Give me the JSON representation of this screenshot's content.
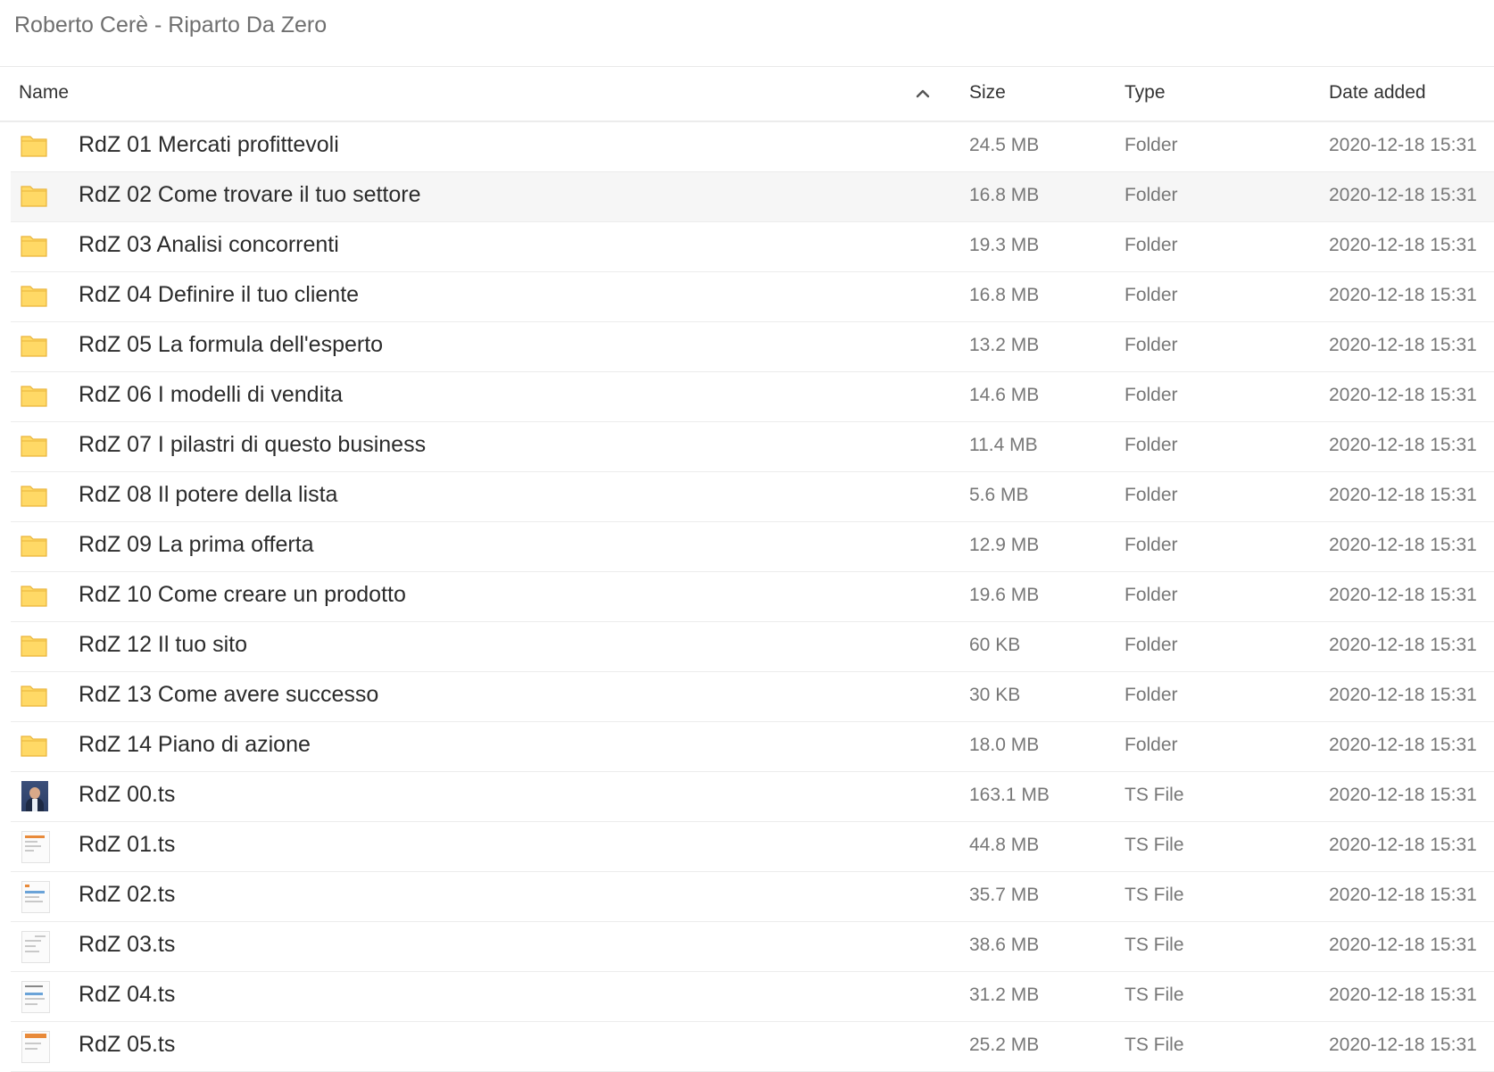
{
  "breadcrumb": {
    "path": "Roberto Cerè - Riparto Da Zero"
  },
  "columns": {
    "name": "Name",
    "size": "Size",
    "type": "Type",
    "date_added": "Date added"
  },
  "rows": [
    {
      "name": "RdZ 01 Mercati profittevoli",
      "size": "24.5 MB",
      "type": "Folder",
      "date": "2020-12-18 15:31",
      "icon": "folder-icon"
    },
    {
      "name": "RdZ 02 Come trovare il tuo settore",
      "size": "16.8 MB",
      "type": "Folder",
      "date": "2020-12-18 15:31",
      "icon": "folder-icon"
    },
    {
      "name": "RdZ 03 Analisi concorrenti",
      "size": "19.3 MB",
      "type": "Folder",
      "date": "2020-12-18 15:31",
      "icon": "folder-icon"
    },
    {
      "name": "RdZ 04 Definire il tuo cliente",
      "size": "16.8 MB",
      "type": "Folder",
      "date": "2020-12-18 15:31",
      "icon": "folder-icon"
    },
    {
      "name": "RdZ 05 La formula dell'esperto",
      "size": "13.2 MB",
      "type": "Folder",
      "date": "2020-12-18 15:31",
      "icon": "folder-icon"
    },
    {
      "name": "RdZ 06 I modelli di vendita",
      "size": "14.6 MB",
      "type": "Folder",
      "date": "2020-12-18 15:31",
      "icon": "folder-icon"
    },
    {
      "name": "RdZ 07 I pilastri di questo business",
      "size": "11.4 MB",
      "type": "Folder",
      "date": "2020-12-18 15:31",
      "icon": "folder-icon"
    },
    {
      "name": "RdZ 08 Il potere della lista",
      "size": "5.6 MB",
      "type": "Folder",
      "date": "2020-12-18 15:31",
      "icon": "folder-icon"
    },
    {
      "name": "RdZ 09 La prima offerta",
      "size": "12.9 MB",
      "type": "Folder",
      "date": "2020-12-18 15:31",
      "icon": "folder-icon"
    },
    {
      "name": "RdZ 10 Come creare un prodotto",
      "size": "19.6 MB",
      "type": "Folder",
      "date": "2020-12-18 15:31",
      "icon": "folder-icon"
    },
    {
      "name": "RdZ 12 Il tuo sito",
      "size": "60 KB",
      "type": "Folder",
      "date": "2020-12-18 15:31",
      "icon": "folder-icon"
    },
    {
      "name": "RdZ 13 Come avere successo",
      "size": "30 KB",
      "type": "Folder",
      "date": "2020-12-18 15:31",
      "icon": "folder-icon"
    },
    {
      "name": "RdZ 14 Piano di azione",
      "size": "18.0 MB",
      "type": "Folder",
      "date": "2020-12-18 15:31",
      "icon": "folder-icon"
    },
    {
      "name": "RdZ 00.ts",
      "size": "163.1 MB",
      "type": "TS File",
      "date": "2020-12-18 15:31",
      "icon": "video-thumbnail-icon"
    },
    {
      "name": "RdZ 01.ts",
      "size": "44.8 MB",
      "type": "TS File",
      "date": "2020-12-18 15:31",
      "icon": "video-thumbnail-icon"
    },
    {
      "name": "RdZ 02.ts",
      "size": "35.7 MB",
      "type": "TS File",
      "date": "2020-12-18 15:31",
      "icon": "video-thumbnail-icon"
    },
    {
      "name": "RdZ 03.ts",
      "size": "38.6 MB",
      "type": "TS File",
      "date": "2020-12-18 15:31",
      "icon": "video-thumbnail-icon"
    },
    {
      "name": "RdZ 04.ts",
      "size": "31.2 MB",
      "type": "TS File",
      "date": "2020-12-18 15:31",
      "icon": "video-thumbnail-icon"
    },
    {
      "name": "RdZ 05.ts",
      "size": "25.2 MB",
      "type": "TS File",
      "date": "2020-12-18 15:31",
      "icon": "video-thumbnail-icon"
    }
  ],
  "colors": {
    "folder": "#FFD966",
    "folder_stroke": "#E9B53B",
    "hover_row": "#F6F6F6"
  }
}
